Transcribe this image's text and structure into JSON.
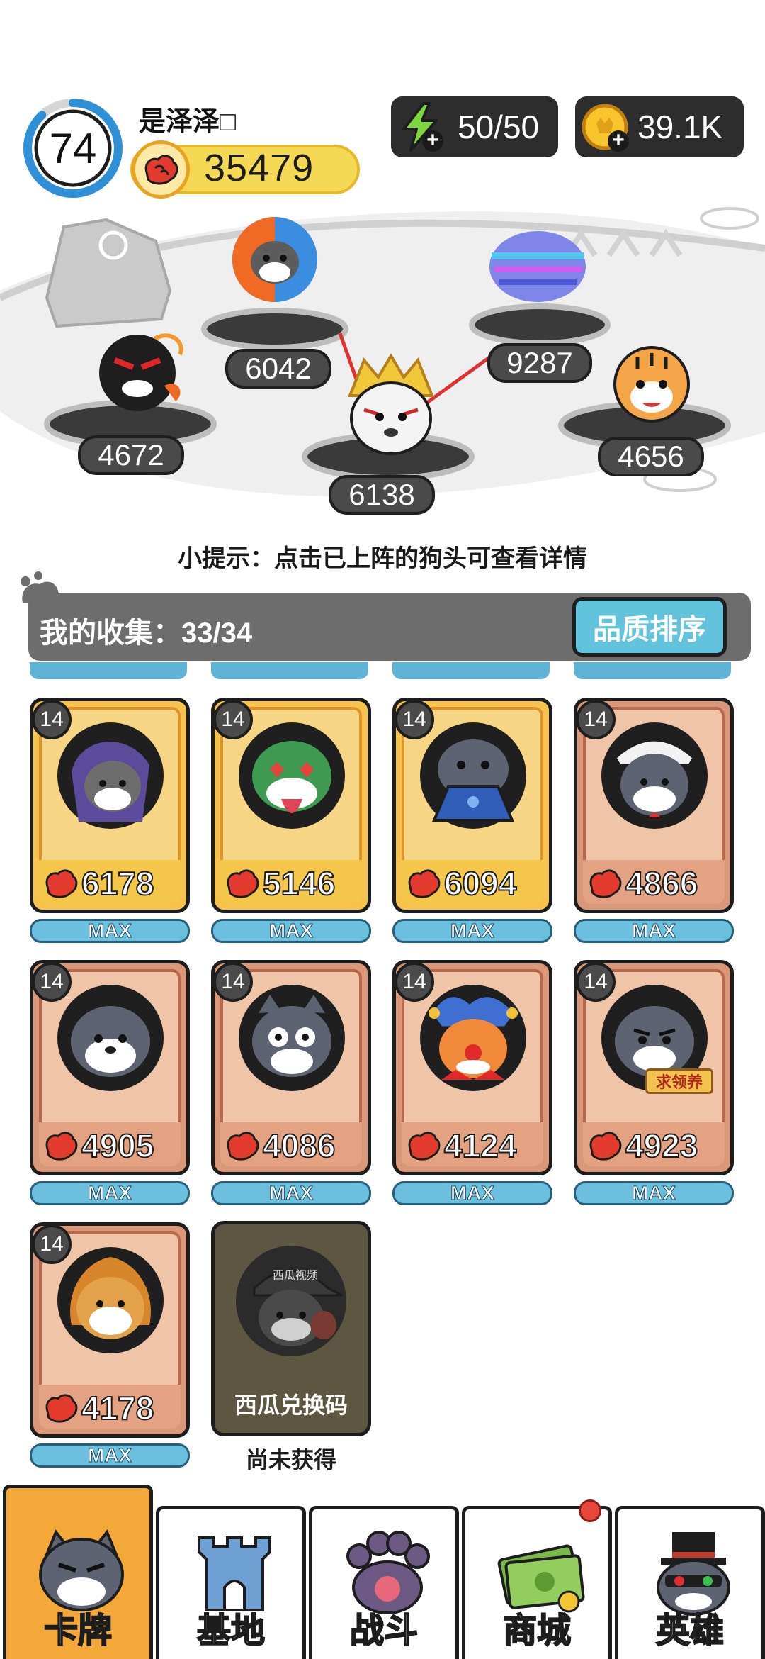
{
  "header": {
    "level": "74",
    "level_progress": 0.88,
    "player_name": "是泽泽□",
    "power": "35479",
    "energy": "50/50",
    "coins": "39.1K"
  },
  "arena": {
    "slots": [
      {
        "name": "fire-ice-dog",
        "power": "6042"
      },
      {
        "name": "glitch-dog",
        "power": "9287"
      },
      {
        "name": "bomb-dog",
        "power": "4672"
      },
      {
        "name": "golden-helmet-dog",
        "power": "6138"
      },
      {
        "name": "tiger-dog",
        "power": "4656"
      }
    ]
  },
  "tip": "小提示：点击已上阵的狗头可查看详情",
  "collection": {
    "label": "我的收集：33/34",
    "sort_button": "品质排序",
    "max_label": "MAX",
    "cards": [
      {
        "level": "14",
        "power": "6178",
        "rarity": "gold",
        "character": "wizard-dog"
      },
      {
        "level": "14",
        "power": "5146",
        "rarity": "gold",
        "character": "heart-eyes-dog"
      },
      {
        "level": "14",
        "power": "6094",
        "rarity": "gold",
        "character": "laptop-dog"
      },
      {
        "level": "14",
        "power": "4866",
        "rarity": "bronze",
        "character": "maid-dog"
      },
      {
        "level": "14",
        "power": "4905",
        "rarity": "bronze",
        "character": "plain-dog"
      },
      {
        "level": "14",
        "power": "4086",
        "rarity": "bronze",
        "character": "goofy-dog"
      },
      {
        "level": "14",
        "power": "4124",
        "rarity": "bronze",
        "character": "clown-dog"
      },
      {
        "level": "14",
        "power": "4923",
        "rarity": "bronze",
        "character": "worried-dog",
        "tag": "求领养"
      },
      {
        "level": "14",
        "power": "4178",
        "rarity": "bronze",
        "character": "flame-dog"
      }
    ],
    "locked_card": {
      "label": "西瓜兑换码",
      "hat_text": "西瓜视频",
      "status": "尚未获得"
    }
  },
  "nav": {
    "tabs": [
      {
        "label": "卡牌",
        "icon": "dog-face-icon",
        "active": true
      },
      {
        "label": "基地",
        "icon": "castle-icon",
        "active": false
      },
      {
        "label": "战斗",
        "icon": "paw-icon",
        "active": false
      },
      {
        "label": "商城",
        "icon": "cash-icon",
        "active": false,
        "badge": true
      },
      {
        "label": "英雄",
        "icon": "top-hat-dog-icon",
        "active": false
      }
    ]
  },
  "colors": {
    "gold_card": "#f7c34a",
    "bronze_card": "#d9987a",
    "accent_blue": "#62c4dc",
    "active_tab": "#f3a838"
  }
}
